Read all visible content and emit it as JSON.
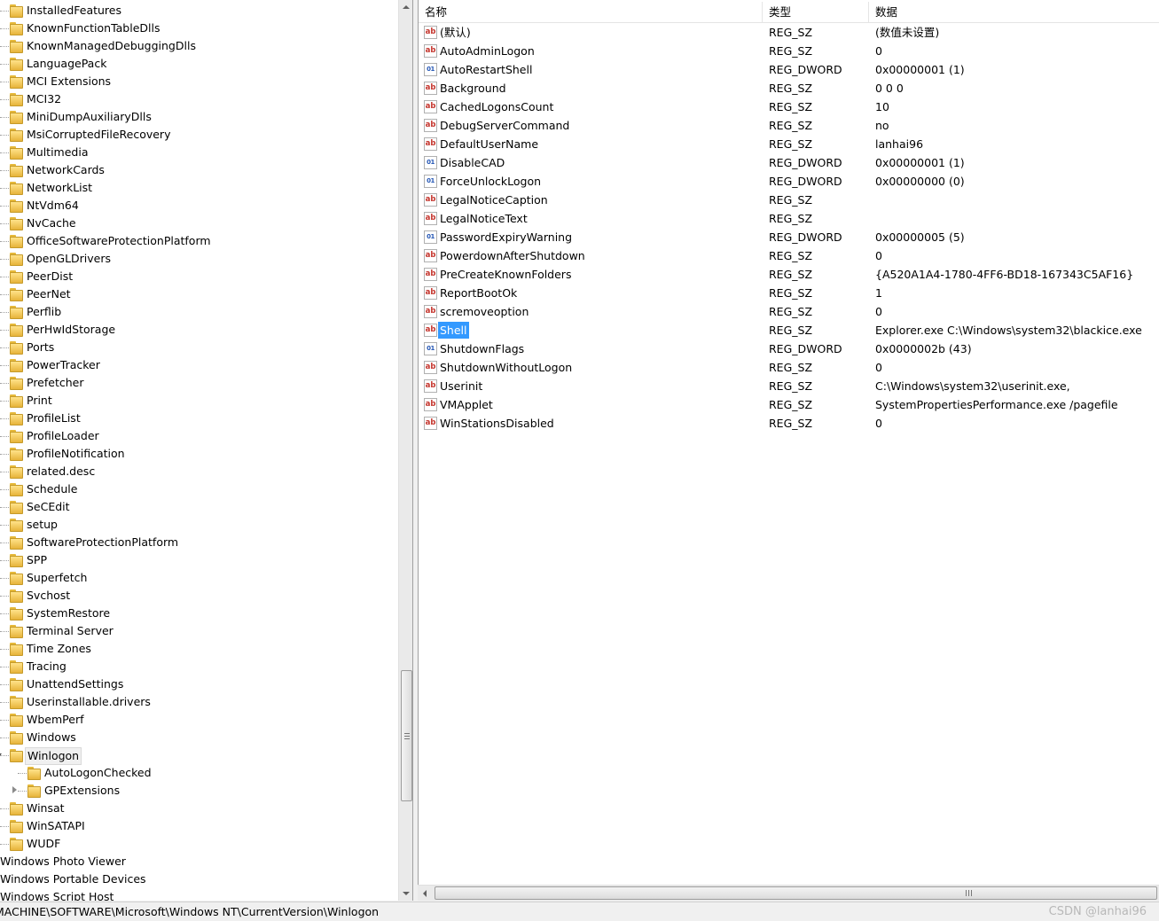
{
  "tree": {
    "items": [
      {
        "label": "InstalledFeatures",
        "level": 1,
        "expander": "closed"
      },
      {
        "label": "KnownFunctionTableDlls",
        "level": 1,
        "expander": "none"
      },
      {
        "label": "KnownManagedDebuggingDlls",
        "level": 1,
        "expander": "none"
      },
      {
        "label": "LanguagePack",
        "level": 1,
        "expander": "closed"
      },
      {
        "label": "MCI Extensions",
        "level": 1,
        "expander": "none"
      },
      {
        "label": "MCI32",
        "level": 1,
        "expander": "none"
      },
      {
        "label": "MiniDumpAuxiliaryDlls",
        "level": 1,
        "expander": "none"
      },
      {
        "label": "MsiCorruptedFileRecovery",
        "level": 1,
        "expander": "closed"
      },
      {
        "label": "Multimedia",
        "level": 1,
        "expander": "closed"
      },
      {
        "label": "NetworkCards",
        "level": 1,
        "expander": "closed"
      },
      {
        "label": "NetworkList",
        "level": 1,
        "expander": "closed"
      },
      {
        "label": "NtVdm64",
        "level": 1,
        "expander": "closed"
      },
      {
        "label": "NvCache",
        "level": 1,
        "expander": "none"
      },
      {
        "label": "OfficeSoftwareProtectionPlatform",
        "level": 1,
        "expander": "none"
      },
      {
        "label": "OpenGLDrivers",
        "level": 1,
        "expander": "closed"
      },
      {
        "label": "PeerDist",
        "level": 1,
        "expander": "closed"
      },
      {
        "label": "PeerNet",
        "level": 1,
        "expander": "none"
      },
      {
        "label": "Perflib",
        "level": 1,
        "expander": "closed"
      },
      {
        "label": "PerHwIdStorage",
        "level": 1,
        "expander": "none"
      },
      {
        "label": "Ports",
        "level": 1,
        "expander": "none"
      },
      {
        "label": "PowerTracker",
        "level": 1,
        "expander": "none"
      },
      {
        "label": "Prefetcher",
        "level": 1,
        "expander": "none"
      },
      {
        "label": "Print",
        "level": 1,
        "expander": "closed"
      },
      {
        "label": "ProfileList",
        "level": 1,
        "expander": "closed"
      },
      {
        "label": "ProfileLoader",
        "level": 1,
        "expander": "none"
      },
      {
        "label": "ProfileNotification",
        "level": 1,
        "expander": "closed"
      },
      {
        "label": "related.desc",
        "level": 1,
        "expander": "none"
      },
      {
        "label": "Schedule",
        "level": 1,
        "expander": "closed"
      },
      {
        "label": "SeCEdit",
        "level": 1,
        "expander": "closed"
      },
      {
        "label": "setup",
        "level": 1,
        "expander": "none"
      },
      {
        "label": "SoftwareProtectionPlatform",
        "level": 1,
        "expander": "closed"
      },
      {
        "label": "SPP",
        "level": 1,
        "expander": "closed"
      },
      {
        "label": "Superfetch",
        "level": 1,
        "expander": "closed"
      },
      {
        "label": "Svchost",
        "level": 1,
        "expander": "none"
      },
      {
        "label": "SystemRestore",
        "level": 1,
        "expander": "closed"
      },
      {
        "label": "Terminal Server",
        "level": 1,
        "expander": "closed"
      },
      {
        "label": "Time Zones",
        "level": 1,
        "expander": "closed"
      },
      {
        "label": "Tracing",
        "level": 1,
        "expander": "closed"
      },
      {
        "label": "UnattendSettings",
        "level": 1,
        "expander": "closed"
      },
      {
        "label": "Userinstallable.drivers",
        "level": 1,
        "expander": "none"
      },
      {
        "label": "WbemPerf",
        "level": 1,
        "expander": "none"
      },
      {
        "label": "Windows",
        "level": 1,
        "expander": "none"
      },
      {
        "label": "Winlogon",
        "level": 1,
        "expander": "open",
        "selected": true
      },
      {
        "label": "AutoLogonChecked",
        "level": 2,
        "expander": "none"
      },
      {
        "label": "GPExtensions",
        "level": 2,
        "expander": "closed"
      },
      {
        "label": "Winsat",
        "level": 1,
        "expander": "closed"
      },
      {
        "label": "WinSATAPI",
        "level": 1,
        "expander": "closed"
      },
      {
        "label": "WUDF",
        "level": 1,
        "expander": "closed"
      },
      {
        "label": "Windows Photo Viewer",
        "level": 0,
        "expander": "none"
      },
      {
        "label": "Windows Portable Devices",
        "level": 0,
        "expander": "none"
      },
      {
        "label": "Windows Script Host",
        "level": 0,
        "expander": "none"
      }
    ]
  },
  "list": {
    "columns": {
      "name": "名称",
      "type": "类型",
      "data": "数据"
    },
    "rows": [
      {
        "name": "(默认)",
        "type": "REG_SZ",
        "data": "(数值未设置)",
        "icon": "string-value-icon"
      },
      {
        "name": "AutoAdminLogon",
        "type": "REG_SZ",
        "data": "0",
        "icon": "string-value-icon"
      },
      {
        "name": "AutoRestartShell",
        "type": "REG_DWORD",
        "data": "0x00000001 (1)",
        "icon": "binary-value-icon"
      },
      {
        "name": "Background",
        "type": "REG_SZ",
        "data": "0 0 0",
        "icon": "string-value-icon"
      },
      {
        "name": "CachedLogonsCount",
        "type": "REG_SZ",
        "data": "10",
        "icon": "string-value-icon"
      },
      {
        "name": "DebugServerCommand",
        "type": "REG_SZ",
        "data": "no",
        "icon": "string-value-icon"
      },
      {
        "name": "DefaultUserName",
        "type": "REG_SZ",
        "data": "lanhai96",
        "icon": "string-value-icon"
      },
      {
        "name": "DisableCAD",
        "type": "REG_DWORD",
        "data": "0x00000001 (1)",
        "icon": "binary-value-icon"
      },
      {
        "name": "ForceUnlockLogon",
        "type": "REG_DWORD",
        "data": "0x00000000 (0)",
        "icon": "binary-value-icon"
      },
      {
        "name": "LegalNoticeCaption",
        "type": "REG_SZ",
        "data": "",
        "icon": "string-value-icon"
      },
      {
        "name": "LegalNoticeText",
        "type": "REG_SZ",
        "data": "",
        "icon": "string-value-icon"
      },
      {
        "name": "PasswordExpiryWarning",
        "type": "REG_DWORD",
        "data": "0x00000005 (5)",
        "icon": "binary-value-icon"
      },
      {
        "name": "PowerdownAfterShutdown",
        "type": "REG_SZ",
        "data": "0",
        "icon": "string-value-icon"
      },
      {
        "name": "PreCreateKnownFolders",
        "type": "REG_SZ",
        "data": "{A520A1A4-1780-4FF6-BD18-167343C5AF16}",
        "icon": "string-value-icon"
      },
      {
        "name": "ReportBootOk",
        "type": "REG_SZ",
        "data": "1",
        "icon": "string-value-icon"
      },
      {
        "name": "scremoveoption",
        "type": "REG_SZ",
        "data": "0",
        "icon": "string-value-icon"
      },
      {
        "name": "Shell",
        "type": "REG_SZ",
        "data": "Explorer.exe C:\\Windows\\system32\\blackice.exe",
        "icon": "string-value-icon",
        "selected": true
      },
      {
        "name": "ShutdownFlags",
        "type": "REG_DWORD",
        "data": "0x0000002b (43)",
        "icon": "binary-value-icon"
      },
      {
        "name": "ShutdownWithoutLogon",
        "type": "REG_SZ",
        "data": "0",
        "icon": "string-value-icon"
      },
      {
        "name": "Userinit",
        "type": "REG_SZ",
        "data": "C:\\Windows\\system32\\userinit.exe,",
        "icon": "string-value-icon"
      },
      {
        "name": "VMApplet",
        "type": "REG_SZ",
        "data": "SystemPropertiesPerformance.exe /pagefile",
        "icon": "string-value-icon"
      },
      {
        "name": "WinStationsDisabled",
        "type": "REG_SZ",
        "data": "0",
        "icon": "string-value-icon"
      }
    ]
  },
  "icons": {
    "string": "ab",
    "binary": "011\n110"
  },
  "status_bar": {
    "path": "MACHINE\\SOFTWARE\\Microsoft\\Windows NT\\CurrentVersion\\Winlogon",
    "watermark": "CSDN @lanhai96"
  }
}
